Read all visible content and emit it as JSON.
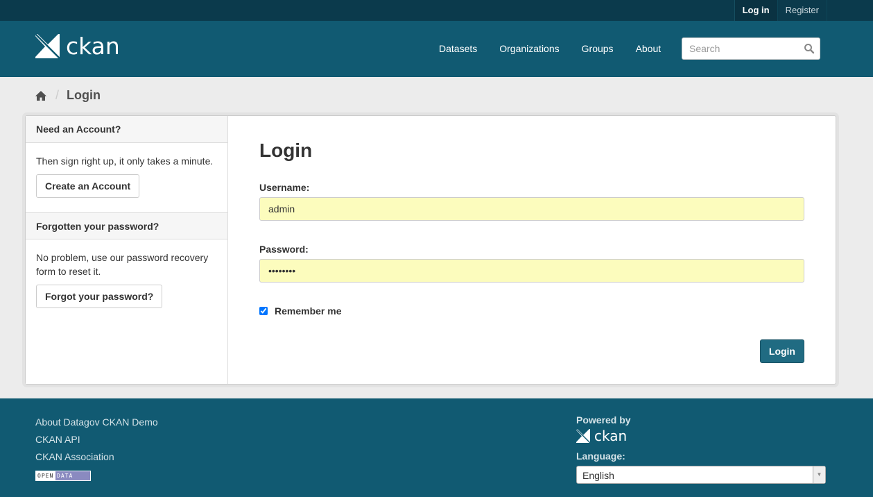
{
  "account": {
    "login_label": "Log in",
    "register_label": "Register"
  },
  "header": {
    "logo_text": "ckan",
    "nav": [
      "Datasets",
      "Organizations",
      "Groups",
      "About"
    ],
    "search_placeholder": "Search"
  },
  "breadcrumb": {
    "current": "Login"
  },
  "sidebar": {
    "account_heading": "Need an Account?",
    "account_text": "Then sign right up, it only takes a minute.",
    "account_button": "Create an Account",
    "password_heading": "Forgotten your password?",
    "password_text": "No problem, use our password recovery form to reset it.",
    "password_button": "Forgot your password?"
  },
  "form": {
    "title": "Login",
    "username_label": "Username:",
    "username_value": "admin",
    "password_label": "Password:",
    "password_value": "••••••••",
    "remember_label": "Remember me",
    "remember_checked": true,
    "submit_label": "Login"
  },
  "footer": {
    "links": [
      "About Datagov CKAN Demo",
      "CKAN API",
      "CKAN Association"
    ],
    "badge_left": "OPEN",
    "badge_right": "DATA",
    "powered_by": "Powered by",
    "powered_logo_text": "ckan",
    "language_label": "Language:",
    "language_value": "English"
  },
  "colors": {
    "masthead": "#115a72",
    "account_bar": "#0b3a4c",
    "primary_button": "#206b82",
    "autofill_input": "#fcfcbd"
  }
}
